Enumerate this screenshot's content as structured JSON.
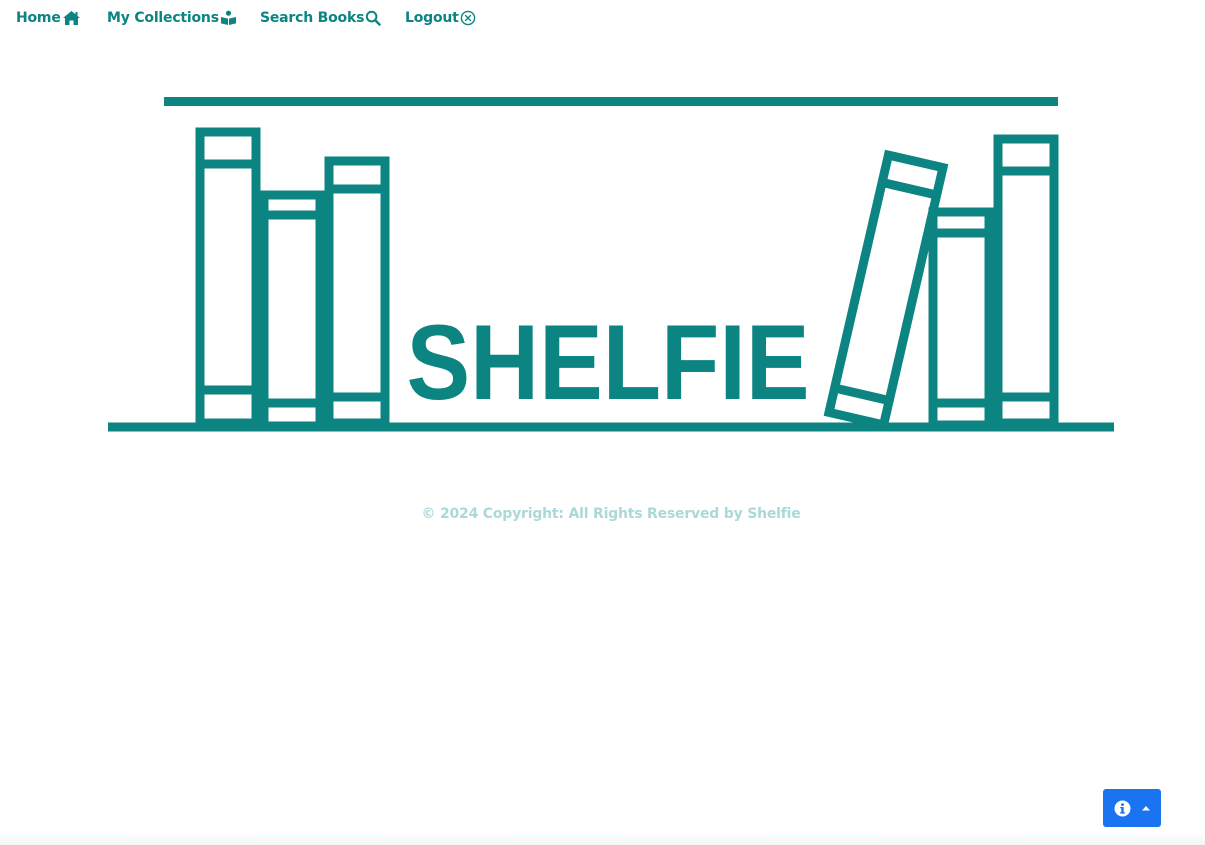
{
  "nav": {
    "items": [
      {
        "label": "Home",
        "icon": "home-icon"
      },
      {
        "label": "My Collections",
        "icon": "book-reader-icon"
      },
      {
        "label": "Search Books",
        "icon": "search-icon"
      },
      {
        "label": "Logout",
        "icon": "close-circle-icon"
      }
    ]
  },
  "logo": {
    "text": "SHELFIE",
    "color": "#0b8482"
  },
  "footer": {
    "copyright": "© 2024 Copyright: All Rights Reserved by Shelfie"
  },
  "info_button": {
    "icons": [
      "info-circle-icon",
      "caret-up-icon"
    ],
    "color": "#1a73f0"
  },
  "colors": {
    "accent": "#0b8482",
    "footer_text": "#a9d9d8"
  }
}
